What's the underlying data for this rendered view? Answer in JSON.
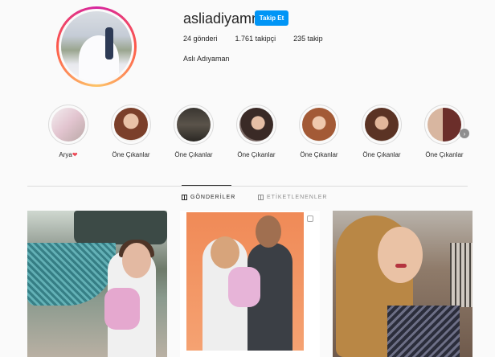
{
  "profile": {
    "username": "asliadiyamn",
    "follow_label": "Takip Et",
    "stats": {
      "posts": "24 gönderi",
      "followers": "1.761 takipçi",
      "following": "235 takip"
    },
    "full_name": "Aslı Adıyaman"
  },
  "highlights": [
    {
      "label": "Arya",
      "suffix": "❤"
    },
    {
      "label": "Öne Çıkanlar"
    },
    {
      "label": "Öne Çıkanlar"
    },
    {
      "label": "Öne Çıkanlar"
    },
    {
      "label": "Öne Çıkanlar"
    },
    {
      "label": "Öne Çıkanlar"
    },
    {
      "label": "Öne Çıkanlar"
    }
  ],
  "highlight_next_icon": "chevron-right-icon",
  "tabs": {
    "posts": {
      "label": "GÖNDERİLER",
      "icon": "grid-icon",
      "active": true
    },
    "tagged": {
      "label": "ETİKETLENENLER",
      "icon": "tag-icon",
      "active": false
    }
  },
  "posts": [
    {
      "alt": "post-1"
    },
    {
      "alt": "post-2"
    },
    {
      "alt": "post-3"
    }
  ],
  "colors": {
    "accent": "#0095f6",
    "heart": "#ed4956",
    "text": "#262626",
    "muted": "#8e8e8e",
    "border": "#dbdbdb"
  }
}
